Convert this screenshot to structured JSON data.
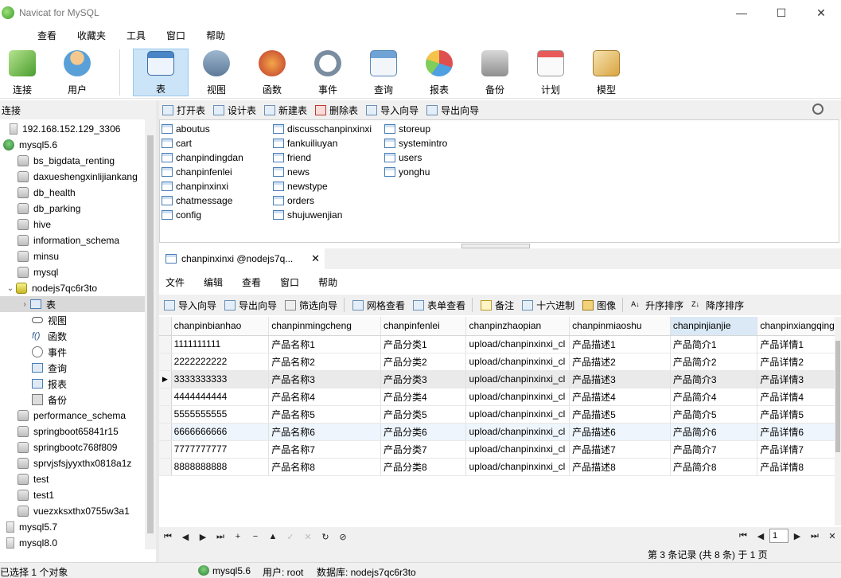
{
  "window": {
    "title": "Navicat for MySQL",
    "minimize": "—",
    "maximize": "☐",
    "close": "✕"
  },
  "menu": [
    "查看",
    "收藏夹",
    "工具",
    "窗口",
    "帮助"
  ],
  "toolbar": [
    {
      "label": "连接",
      "icon": "connection-icon"
    },
    {
      "label": "用户",
      "icon": "user-icon"
    },
    {
      "label": "表",
      "icon": "table-icon",
      "active": true
    },
    {
      "label": "视图",
      "icon": "view-icon"
    },
    {
      "label": "函数",
      "icon": "function-icon"
    },
    {
      "label": "事件",
      "icon": "event-icon"
    },
    {
      "label": "查询",
      "icon": "query-icon"
    },
    {
      "label": "报表",
      "icon": "report-icon"
    },
    {
      "label": "备份",
      "icon": "backup-icon"
    },
    {
      "label": "计划",
      "icon": "schedule-icon"
    },
    {
      "label": "模型",
      "icon": "model-icon"
    }
  ],
  "left": {
    "header": "连接",
    "server": "192.168.152.129_3306",
    "conn_mysql56": "mysql5.6",
    "databases_before": [
      "bs_bigdata_renting",
      "daxueshengxinlijiankang",
      "db_health",
      "db_parking",
      "hive",
      "information_schema",
      "minsu",
      "mysql"
    ],
    "open_db": "nodejs7qc6r3to",
    "open_db_children": [
      "表",
      "视图",
      "函数",
      "事件",
      "查询",
      "报表",
      "备份"
    ],
    "databases_after": [
      "performance_schema",
      "springboot65841r15",
      "springbootc768f809",
      "sprvjsfsjyyxthx0818a1z",
      "test",
      "test1",
      "vuezxksxthx0755w3a1"
    ],
    "other_conns": [
      "mysql5.7",
      "mysql8.0"
    ]
  },
  "objbar": [
    "打开表",
    "设计表",
    "新建表",
    "删除表",
    "导入向导",
    "导出向导"
  ],
  "tables": {
    "col1": [
      "aboutus",
      "cart",
      "chanpindingdan",
      "chanpinfenlei",
      "chanpinxinxi",
      "chatmessage",
      "config"
    ],
    "col2": [
      "discusschanpinxinxi",
      "fankuiliuyan",
      "friend",
      "news",
      "newstype",
      "orders",
      "shujuwenjian"
    ],
    "col3": [
      "storeup",
      "systemintro",
      "users",
      "yonghu"
    ]
  },
  "tab": {
    "label": "chanpinxinxi @nodejs7q...",
    "close": "✕"
  },
  "submenu": [
    "文件",
    "编辑",
    "查看",
    "窗口",
    "帮助"
  ],
  "gridbar": [
    "导入向导",
    "导出向导",
    "筛选向导",
    "网格查看",
    "表单查看",
    "备注",
    "十六进制",
    "图像",
    "升序排序",
    "降序排序"
  ],
  "grid": {
    "columns": [
      "chanpinbianhao",
      "chanpinmingcheng",
      "chanpinfenlei",
      "chanpinzhaopian",
      "chanpinmiaoshu",
      "chanpinjianjie",
      "chanpinxiangqing"
    ],
    "rows": [
      [
        "1111111111",
        "产品名称1",
        "产品分类1",
        "upload/chanpinxinxi_cl",
        "产品描述1",
        "产品简介1",
        "产品详情1"
      ],
      [
        "2222222222",
        "产品名称2",
        "产品分类2",
        "upload/chanpinxinxi_cl",
        "产品描述2",
        "产品简介2",
        "产品详情2"
      ],
      [
        "3333333333",
        "产品名称3",
        "产品分类3",
        "upload/chanpinxinxi_cl",
        "产品描述3",
        "产品简介3",
        "产品详情3"
      ],
      [
        "4444444444",
        "产品名称4",
        "产品分类4",
        "upload/chanpinxinxi_cl",
        "产品描述4",
        "产品简介4",
        "产品详情4"
      ],
      [
        "5555555555",
        "产品名称5",
        "产品分类5",
        "upload/chanpinxinxi_cl",
        "产品描述5",
        "产品简介5",
        "产品详情5"
      ],
      [
        "6666666666",
        "产品名称6",
        "产品分类6",
        "upload/chanpinxinxi_cl",
        "产品描述6",
        "产品简介6",
        "产品详情6"
      ],
      [
        "7777777777",
        "产品名称7",
        "产品分类7",
        "upload/chanpinxinxi_cl",
        "产品描述7",
        "产品简介7",
        "产品详情7"
      ],
      [
        "8888888888",
        "产品名称8",
        "产品分类8",
        "upload/chanpinxinxi_cl",
        "产品描述8",
        "产品简介8",
        "产品详情8"
      ]
    ],
    "current_row": 3
  },
  "nav": {
    "page": "1"
  },
  "record_info": "第 3 条记录 (共 8 条) 于 1 页",
  "status": {
    "selected": "已选择 1 个对象",
    "connection": "mysql5.6",
    "user": "用户: root",
    "database": "数据库: nodejs7qc6r3to"
  }
}
